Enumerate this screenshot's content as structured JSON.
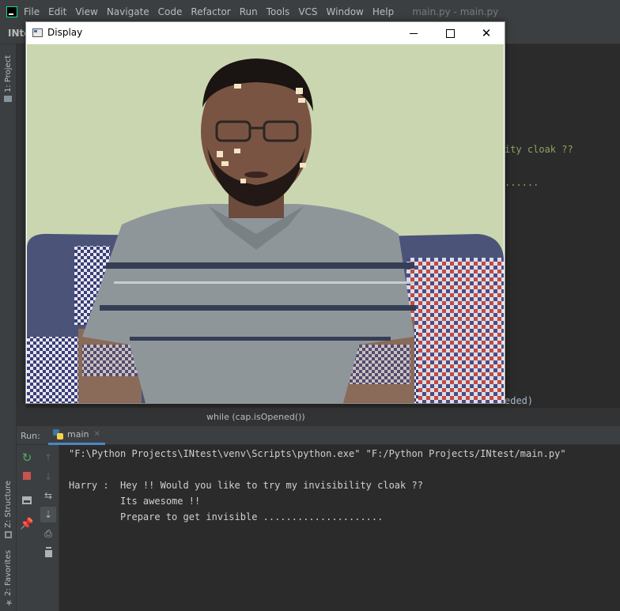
{
  "menu": {
    "items": [
      {
        "label": "File"
      },
      {
        "label": "Edit"
      },
      {
        "label": "View"
      },
      {
        "label": "Navigate"
      },
      {
        "label": "Code"
      },
      {
        "label": "Refactor"
      },
      {
        "label": "Run"
      },
      {
        "label": "Tools"
      },
      {
        "label": "VCS"
      },
      {
        "label": "Window"
      },
      {
        "label": "Help"
      }
    ],
    "window_title": "main.py - main.py"
  },
  "project": {
    "name_partial": "INte"
  },
  "left_strip": {
    "project_tab": "1: Project",
    "structure_tab": "Z: Structure",
    "favorites_tab": "2: Favorites"
  },
  "editor": {
    "visible_fragment_1": "ity cloak ??",
    "visible_fragment_2": "......",
    "visible_fragment_3": "eded)"
  },
  "breadcrumb": {
    "text": "while (cap.isOpened())"
  },
  "run_panel": {
    "label": "Run:",
    "tab_label": "main"
  },
  "console": {
    "lines": [
      "\"F:\\Python Projects\\INtest\\venv\\Scripts\\python.exe\" \"F:/Python Projects/INtest/main.py\"",
      "",
      "Harry :  Hey !! Would you like to try my invisibility cloak ??",
      "         Its awesome !!",
      "         Prepare to get invisible ....................."
    ]
  },
  "display_window": {
    "title": "Display",
    "close_glyph": "✕"
  },
  "colors": {
    "ide_bg": "#2b2b2b",
    "ide_panel": "#3c3f41",
    "accent_tab": "#4a88c7",
    "console_text": "#d0d0d0",
    "run_icon": "#59a869",
    "stop_icon": "#c75450"
  }
}
